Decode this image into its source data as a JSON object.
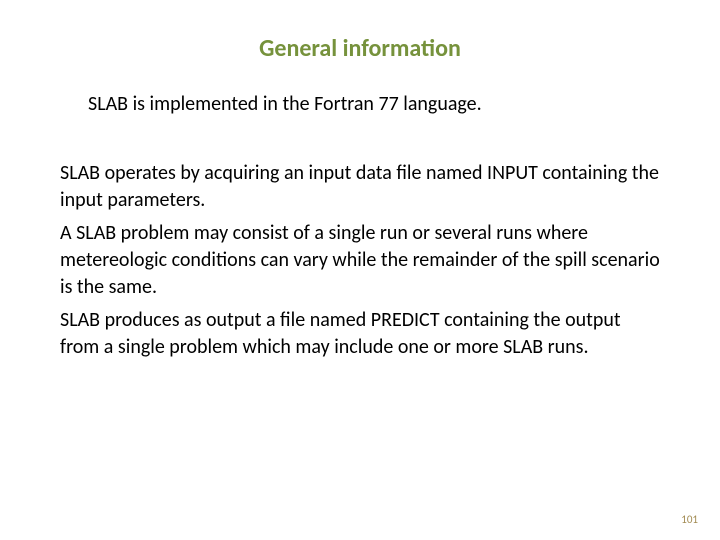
{
  "title": "General information",
  "intro": "SLAB is implemented in the Fortran 77 language.",
  "p1": "SLAB operates by acquiring an input data file named INPUT containing the input parameters.",
  "p2": "A SLAB problem may consist of a single run or several runs where metereologic conditions can vary while the remainder of the spill scenario is the same.",
  "p3": "SLAB produces  as output a file named PREDICT containing the output from a single problem  which may include one or more SLAB runs.",
  "page": "101"
}
